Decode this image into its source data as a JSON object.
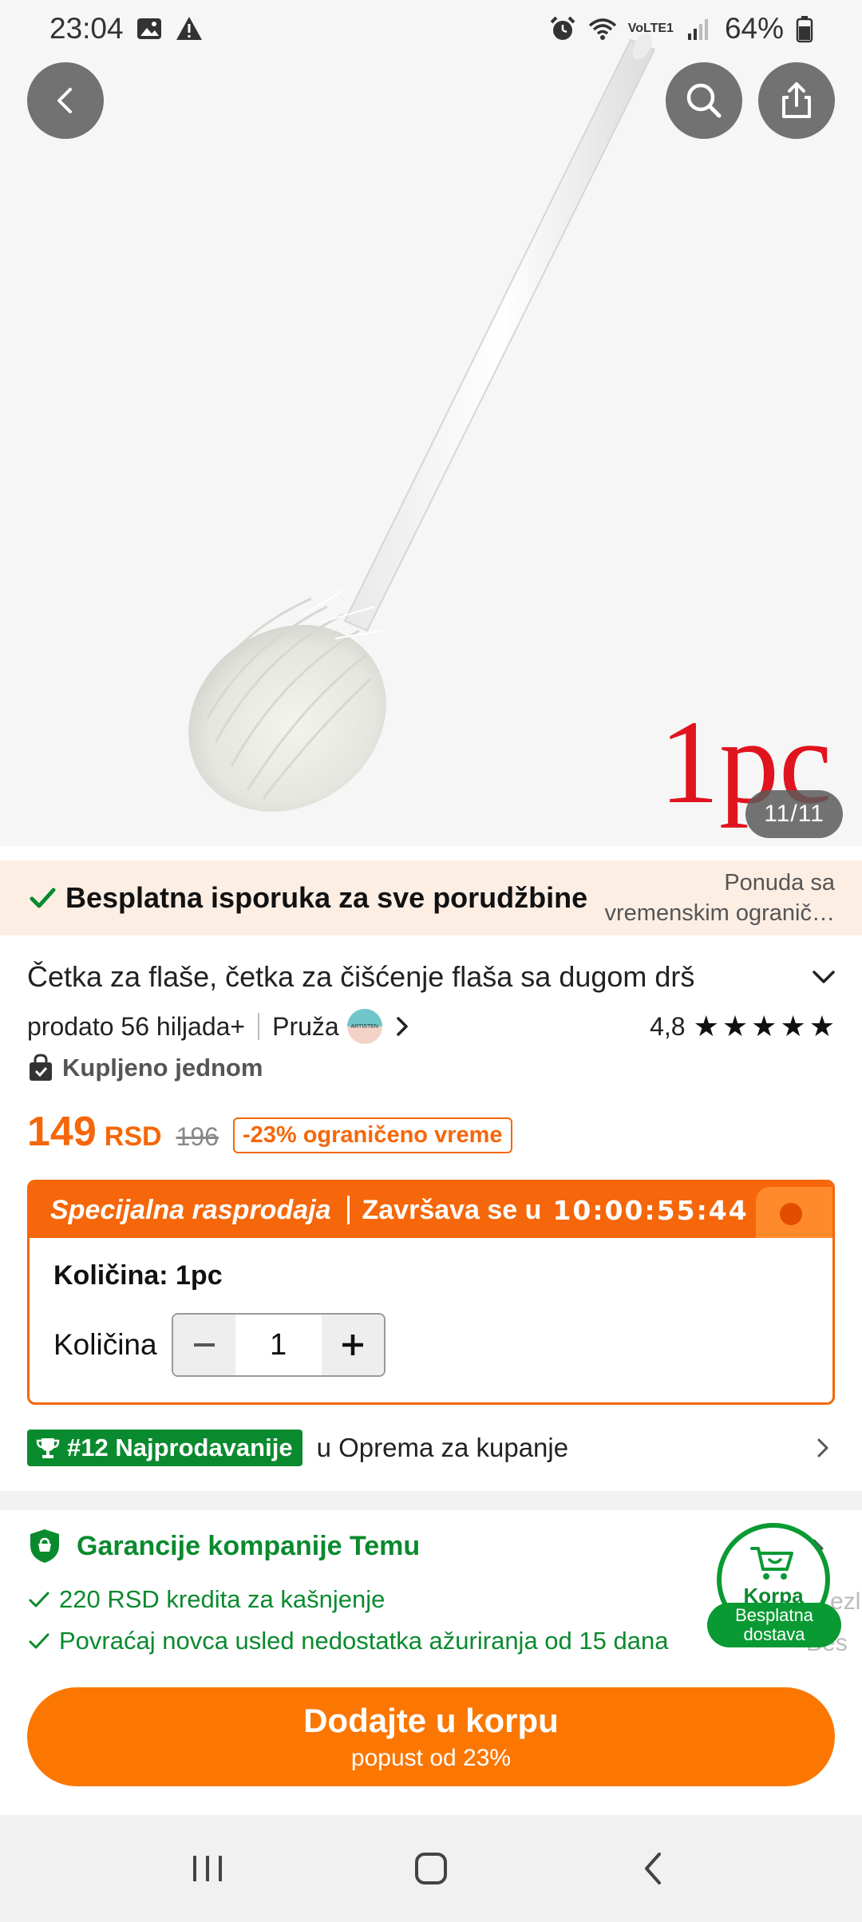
{
  "status_bar": {
    "time": "23:04",
    "network": "VoLTE1",
    "battery": "64%",
    "icons": [
      "gallery-icon",
      "warning-icon",
      "alarm-icon",
      "wifi-icon",
      "signal-icon",
      "battery-icon"
    ]
  },
  "hero": {
    "counter": "11/11",
    "tag": "1pc",
    "actions": [
      "back-icon",
      "search-icon",
      "share-icon"
    ]
  },
  "shipping": {
    "text": "Besplatna isporuka za sve porudžbine",
    "offer": "Ponuda sa vremenskim ogranič…"
  },
  "product": {
    "title": "Četka za flaše, četka za čišćenje flaša sa dugom drš",
    "sold": "prodato 56 hiljada+",
    "provider_label": "Pruža",
    "provider_name": "ARTISTEN",
    "rating": "4,8",
    "stars": 5,
    "bought": "Kupljeno jednom"
  },
  "price": {
    "value": "149",
    "currency": "RSD",
    "old": "196",
    "discount": "-23% ograničeno vreme"
  },
  "sale": {
    "title": "Specijalna rasprodaja",
    "ends_label": "Završava se u",
    "timer": "10:00:55:44",
    "quantity_title": "Količina: 1pc",
    "quantity_label": "Količina",
    "quantity_value": "1"
  },
  "bestseller": {
    "badge": "#12 Najprodavanije",
    "category": "u Oprema za kupanje"
  },
  "guarantee": {
    "title": "Garancije kompanije Temu",
    "items": [
      "220 RSD kredita za kašnjenje",
      "Povraćaj novca usled nedostatka ažuriranja od 15 dana"
    ],
    "peek_1": "ezl",
    "peek_2": "Bes"
  },
  "cart": {
    "label": "Korpa",
    "badge": "Besplatna dostava"
  },
  "cta": {
    "main": "Dodajte u korpu",
    "sub": "popust od 23%"
  },
  "colors": {
    "accent": "#fb7701",
    "price": "#f5670a",
    "green": "#0a8a2e",
    "banner_bg": "#fdeee4"
  }
}
